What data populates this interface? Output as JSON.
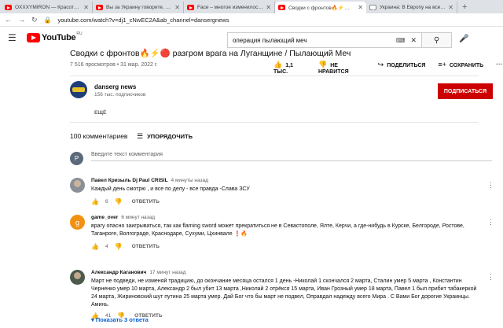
{
  "browser": {
    "tabs": [
      {
        "label": "OXXXYMIRON — Красота и Урод",
        "active": false,
        "icon": "youtube"
      },
      {
        "label": "Вы за Украину говорите, а Вас",
        "active": false,
        "icon": "youtube"
      },
      {
        "label": "Face – многое изменилось / в2",
        "active": false,
        "icon": "youtube"
      },
      {
        "label": "Сводки с фронтов🔥⚡🔴 ра",
        "active": true,
        "icon": "youtube"
      },
      {
        "label": "Украина: В Европу на все деньги",
        "active": false,
        "icon": "flag"
      }
    ],
    "url": "youtube.com/watch?v=dj1_cNwEC2A&ab_channel=dansergnews"
  },
  "header": {
    "logo_text": "YouTube",
    "logo_region": "RU",
    "search_value": "операция пылающий меч"
  },
  "video": {
    "title": "Сводки с фронтов🔥⚡🔴 разгром врага на Луганщине / Пылающий Меч",
    "meta": "7 516 просмотров • 31 мар. 2022 г.",
    "likes": "1,1 ТЫС.",
    "dislike_label": "НЕ НРАВИТСЯ",
    "share_label": "ПОДЕЛИТЬСЯ",
    "save_label": "СОХРАНИТЬ",
    "more_label": "..."
  },
  "channel": {
    "name": "danserg news",
    "subscribers": "156 тыс. подписчиков",
    "subscribe_label": "ПОДПИСАТЬСЯ",
    "show_more": "ЕЩЁ"
  },
  "comments": {
    "count_label": "100 комментариев",
    "sort_label": "УПОРЯДОЧИТЬ",
    "my_avatar": "P",
    "placeholder": "Введите текст комментария",
    "items": [
      {
        "author": "Павел Кризыль Dj Paul CRISIL",
        "time": "4 минуты назад",
        "avatar": "photo",
        "text": "Каждый день смотрю , и все по делу - все  правда -Слава ЗСУ",
        "likes": "6",
        "reply": "ОТВЕТИТЬ"
      },
      {
        "author": "game_over",
        "time": "6 минут назад",
        "avatar": "g",
        "text": "врагу опасно заигрываться, так как flaming sword может прекратиться не в Севастополе, Ялте, Керчи, а где-нибудь в Курске, Белгороде, Ростове, Таганроге, Волгограде, Краснодаре, Сухуми, Цхинвале ❗🔥",
        "likes": "4",
        "reply": "ОТВЕТИТЬ"
      },
      {
        "author": "Александр Каганович",
        "time": "17 минут назад",
        "avatar": "photo",
        "text": "Март не подведи, не изменяй традицию, до окончание месяца остался 1 день  -Николай 1 скончался 2 марта, Сталин умер 5 марта , Константин Черненко умер 10 марта, Александр 2 был убит 13 марта ,Николай 2 отрёкся 15 марта, Иван Грозный умер 18 марта, Павел 1 был прибит  табакеркой 24 марта,  Жириновский шут путина 25 марта умер.  Дай Бог что бы март не подвел, Оправдал надежду всего Мира . С Вами Бог дорогие Украинцы. Аминь.",
        "likes": "41",
        "reply": "ОТВЕТИТЬ"
      }
    ],
    "show_replies": "Показать 3 ответа"
  }
}
